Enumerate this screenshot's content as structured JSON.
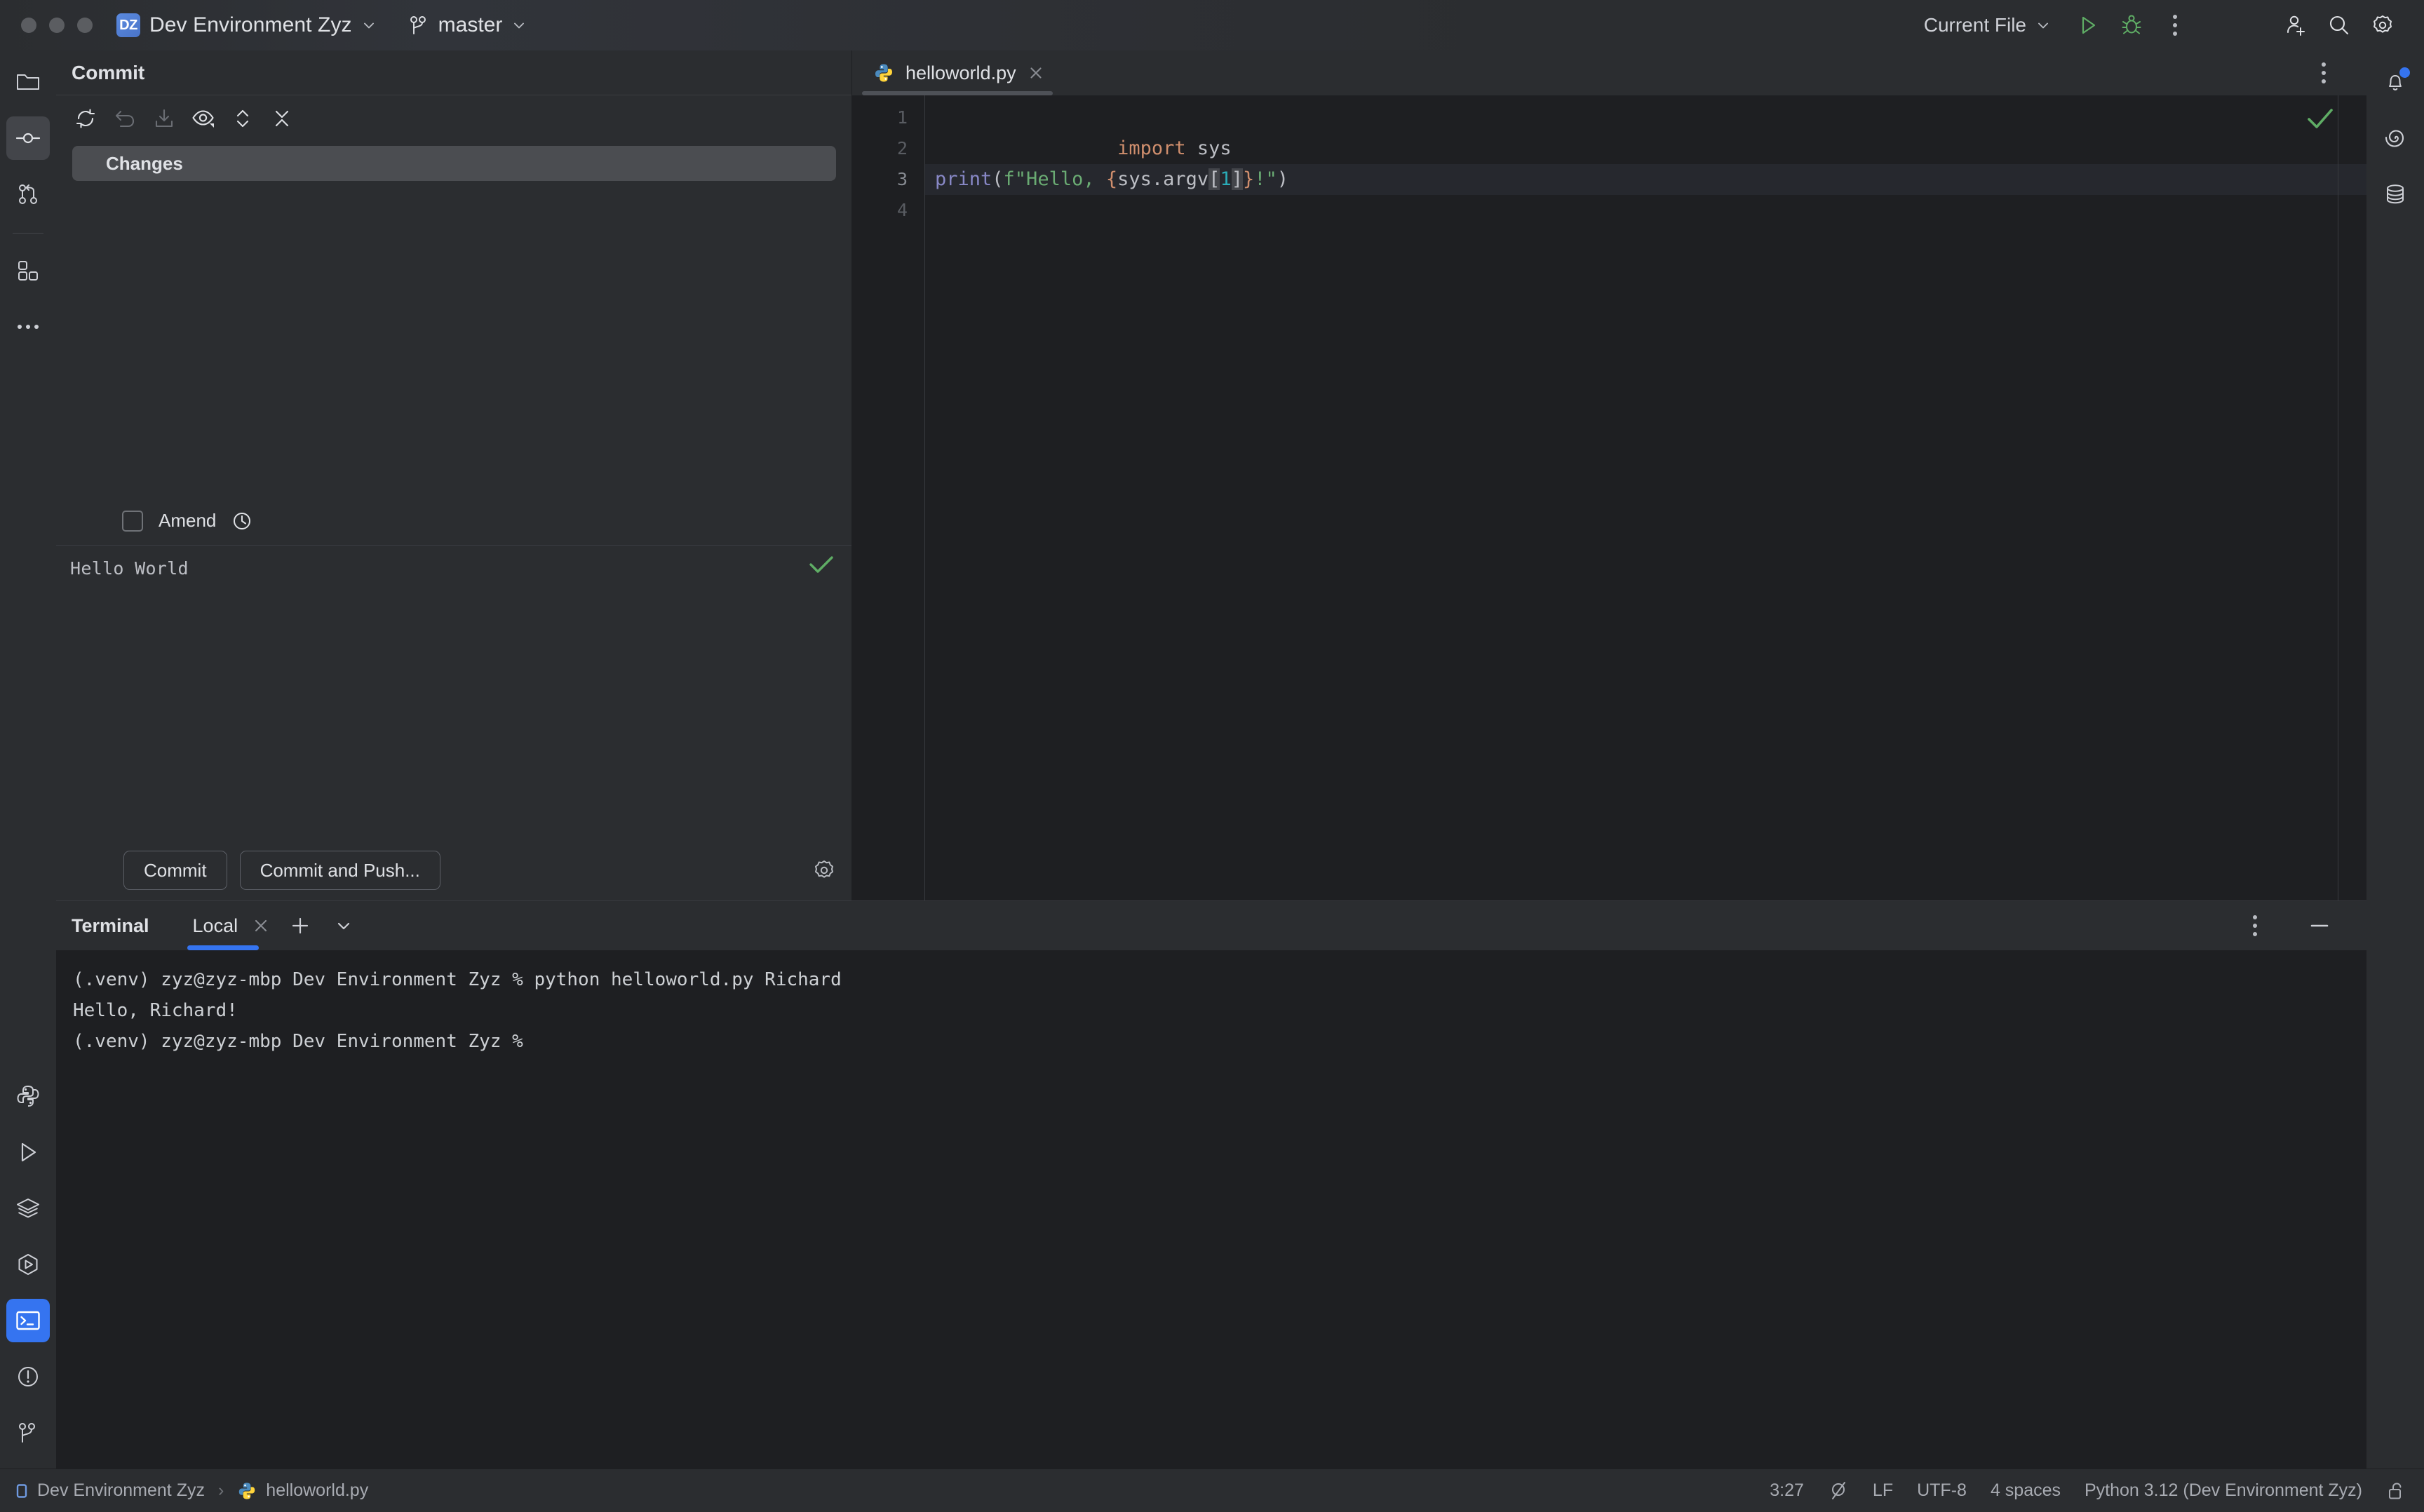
{
  "titlebar": {
    "project_badge": "DZ",
    "project_name": "Dev Environment Zyz",
    "branch": "master",
    "run_config": "Current File",
    "icons": {
      "project_chevron": "chevron-down-icon",
      "branch": "git-branch-icon",
      "branch_chevron": "chevron-down-icon",
      "run": "run-icon",
      "debug": "debug-icon",
      "more": "more-vertical-icon",
      "add_user": "add-user-icon",
      "search": "search-icon",
      "settings": "gear-icon"
    }
  },
  "left_stripe": {
    "top_items": [
      {
        "name": "project",
        "icon": "folder-icon",
        "selected": false
      },
      {
        "name": "commit",
        "icon": "commit-icon",
        "selected": true
      },
      {
        "name": "pull-requests",
        "icon": "pull-request-icon",
        "selected": false
      },
      {
        "name": "plugins",
        "icon": "plugins-icon",
        "selected": false
      },
      {
        "name": "more-tool-windows",
        "icon": "more-horizontal-icon",
        "selected": false
      }
    ],
    "bottom_items": [
      {
        "name": "python-console",
        "icon": "python-icon",
        "selected": false
      },
      {
        "name": "run",
        "icon": "run-icon",
        "selected": false
      },
      {
        "name": "services",
        "icon": "services-icon",
        "selected": false
      },
      {
        "name": "python-packages",
        "icon": "python-packages-icon",
        "selected": false
      },
      {
        "name": "terminal",
        "icon": "terminal-icon",
        "selected": true
      },
      {
        "name": "problems",
        "icon": "problems-icon",
        "selected": false
      },
      {
        "name": "git",
        "icon": "git-branch-icon",
        "selected": false
      }
    ]
  },
  "right_stripe": {
    "items": [
      {
        "name": "notifications",
        "icon": "bell-icon",
        "badge": true
      },
      {
        "name": "ai-assistant",
        "icon": "ai-spiral-icon",
        "badge": false
      },
      {
        "name": "database",
        "icon": "database-icon",
        "badge": false
      }
    ]
  },
  "commit_panel": {
    "title": "Commit",
    "toolbar": [
      {
        "name": "refresh-changes",
        "icon": "refresh-icon"
      },
      {
        "name": "rollback",
        "icon": "undo-icon"
      },
      {
        "name": "shelve-changes",
        "icon": "download-box-icon"
      },
      {
        "name": "show-diff-preview",
        "icon": "eye-icon"
      },
      {
        "name": "expand-collapse",
        "icon": "expand-collapse-icon"
      },
      {
        "name": "collapse-all",
        "icon": "collapse-all-icon"
      }
    ],
    "changes_node": "Changes",
    "amend_label": "Amend",
    "amend_checked": false,
    "history_icon": "clock-icon",
    "message": "Hello World",
    "message_ok_icon": "check-icon",
    "commit_button": "Commit",
    "commit_push_button": "Commit and Push...",
    "settings_icon": "gear-icon"
  },
  "editor": {
    "tab": {
      "label": "helloworld.py",
      "file_icon": "python-file-icon",
      "close_icon": "close-icon"
    },
    "tabbar_more_icon": "more-vertical-icon",
    "inspection_icon": "check-icon",
    "line_numbers": [
      "1",
      "2",
      "3",
      "4"
    ],
    "current_line": 3,
    "lines": [
      {
        "tokens": [
          {
            "t": "import",
            "c": "k-kw"
          },
          {
            "t": " sys",
            "c": "k-plain"
          }
        ]
      },
      {
        "tokens": []
      },
      {
        "tokens": [
          {
            "t": "print",
            "c": "k-fn"
          },
          {
            "t": "(",
            "c": "k-plain"
          },
          {
            "t": "f\"Hello, ",
            "c": "k-str"
          },
          {
            "t": "{",
            "c": "k-brace"
          },
          {
            "t": "sys.argv",
            "c": "k-plain"
          },
          {
            "t": "[",
            "c": "k-plain k-sel"
          },
          {
            "t": "1",
            "c": "k-num"
          },
          {
            "t": "]",
            "c": "k-plain k-sel"
          },
          {
            "t": "}",
            "c": "k-brace"
          },
          {
            "t": "!\"",
            "c": "k-str"
          },
          {
            "t": ")",
            "c": "k-plain"
          }
        ]
      },
      {
        "tokens": []
      }
    ],
    "raw_code": "import sys\n\nprint(f\"Hello, {sys.argv[1]}!\")\n"
  },
  "terminal": {
    "title": "Terminal",
    "tab_label": "Local",
    "tab_close_icon": "close-icon",
    "new_tab_icon": "plus-icon",
    "tab_list_icon": "chevron-down-icon",
    "options_icon": "more-vertical-icon",
    "minimize_icon": "minimize-icon",
    "lines": [
      "(.venv) zyz@zyz-mbp Dev Environment Zyz % python helloworld.py Richard",
      "Hello, Richard!",
      "(.venv) zyz@zyz-mbp Dev Environment Zyz % "
    ]
  },
  "statusbar": {
    "breadcrumb_project": "Dev Environment Zyz",
    "breadcrumb_sep": "›",
    "breadcrumb_file": "helloworld.py",
    "project_icon": "module-icon",
    "file_icon": "python-file-icon",
    "caret_position": "3:27",
    "no_access_icon": "no-access-icon",
    "line_separator": "LF",
    "encoding": "UTF-8",
    "indent": "4 spaces",
    "interpreter": "Python 3.12 (Dev Environment Zyz)",
    "lock_icon": "unlocked-icon"
  },
  "colors": {
    "accent_blue": "#3574f0",
    "panel_bg": "#2b2d30",
    "editor_bg": "#1e1f22",
    "text": "#dfe1e5",
    "muted": "#a8abb2",
    "green": "#6aab73",
    "keyword_orange": "#cf8e6d",
    "function_purple": "#8888c6",
    "number_cyan": "#2aacb8"
  }
}
